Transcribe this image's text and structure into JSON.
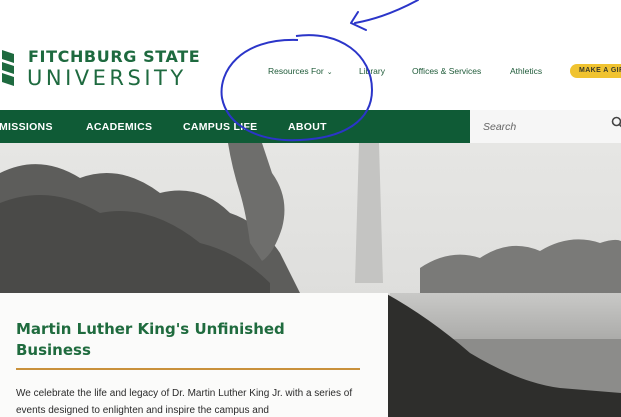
{
  "brand": {
    "line1": "FITCHBURG STATE",
    "line2": "UNIVERSITY",
    "color": "#1e6a3f"
  },
  "utility_nav": [
    {
      "label": "Resources For",
      "icon": "chevron-down-icon"
    },
    {
      "label": "Library"
    },
    {
      "label": "Offices & Services"
    },
    {
      "label": "Athletics"
    }
  ],
  "gift_button": {
    "label": "MAKE A GIFT",
    "color": "#f0c330"
  },
  "main_nav": [
    {
      "label": "MISSIONS"
    },
    {
      "label": "ACADEMICS"
    },
    {
      "label": "CAMPUS LIFE"
    },
    {
      "label": "ABOUT"
    }
  ],
  "nav_color": "#0f5b36",
  "search": {
    "placeholder": "Search",
    "icon": "search-icon"
  },
  "feature": {
    "title": "Martin Luther King's Unfinished Business",
    "body": "We celebrate the life and legacy of Dr. Martin Luther King Jr. with a series of events designed to enlighten and inspire the campus and",
    "rule_color": "#c9913b"
  },
  "annotation": {
    "color": "#2b35c9",
    "shapes": [
      "hand-drawn-circle",
      "hand-drawn-arrow"
    ]
  }
}
